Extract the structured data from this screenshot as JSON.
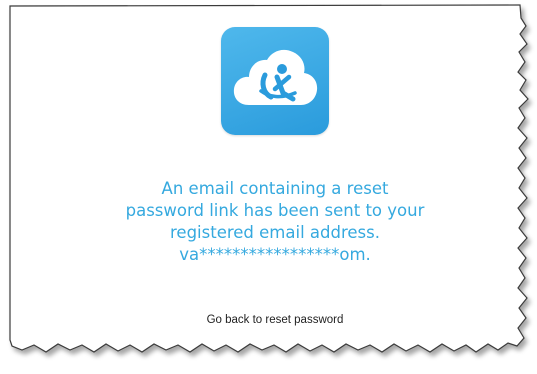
{
  "logo": {
    "icon": "cloud-with-figure-icon",
    "background_color": "#36a7e2"
  },
  "message": {
    "line1": "An email containing a reset",
    "line2": "password link has been sent to your",
    "line3": "registered email address.",
    "line4": "va*****************om.",
    "color": "#35a9df"
  },
  "back_link": {
    "label": "Go back to reset password"
  }
}
